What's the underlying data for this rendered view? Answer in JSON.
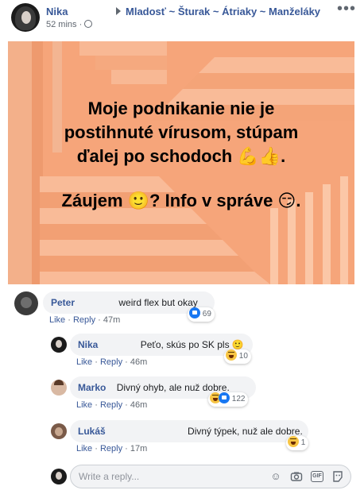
{
  "post": {
    "author": "Nika",
    "group_path": "Mladosť ~ Šturak ~ Átriaky ~ Manželáky",
    "time": "52 mins ·",
    "more_icon": "more-dots-icon",
    "image": {
      "background": "#f7a87c",
      "line1": "Moje podnikanie nie je",
      "line2": "postihnuté vírusom, stúpam",
      "line3": "ďalej po schodoch 💪👍.",
      "line4": "Záujem 🙂? Info v správe 😏."
    }
  },
  "comments": [
    {
      "name": "Peter",
      "text": "weird flex but okay",
      "like": "Like",
      "reply": "Reply",
      "time": "· 47m",
      "reaction_count": "69",
      "reaction_icons": [
        "like-icon"
      ]
    },
    {
      "name": "Nika",
      "text": "Peťo, skús po SK pls 🙂",
      "like": "Like",
      "reply": "Reply",
      "time": "· 46m",
      "reaction_count": "10",
      "reaction_icons": [
        "haha-icon"
      ]
    },
    {
      "name": "Marko",
      "text": "Divný ohyb, ale nuž dobre.",
      "like": "Like",
      "reply": "Reply",
      "time": "· 46m",
      "reaction_count": "122",
      "reaction_icons": [
        "haha-icon",
        "like-icon"
      ]
    },
    {
      "name": "Lukáš",
      "text": "Divný týpek, nuž ale dobre.",
      "like": "Like",
      "reply": "Reply",
      "time": "· 17m",
      "reaction_count": "1",
      "reaction_icons": [
        "haha-icon"
      ]
    }
  ],
  "reply_box": {
    "placeholder": "Write a reply...",
    "icons": [
      "emoji-icon",
      "camera-icon",
      "gif-icon",
      "sticker-icon"
    ]
  },
  "colors": {
    "link": "#385898",
    "bubble": "#f2f3f5",
    "image_bg": "#f7a87c"
  }
}
